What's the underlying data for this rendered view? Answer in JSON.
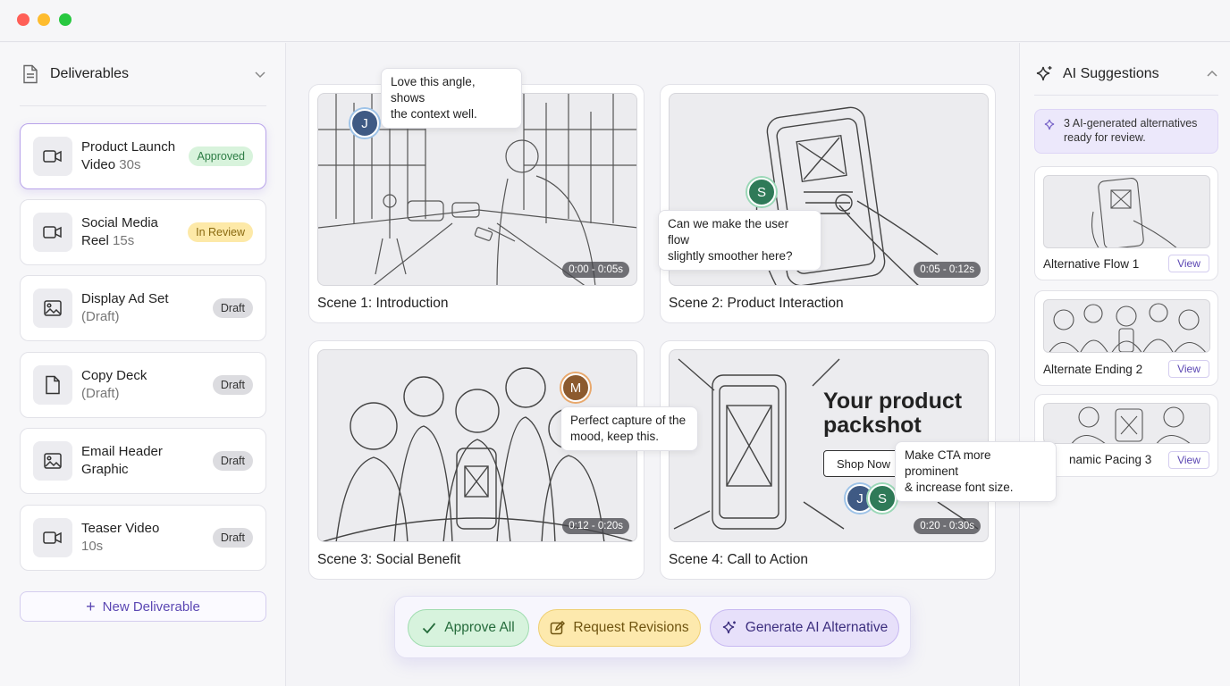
{
  "sidebar": {
    "title": "Deliverables",
    "items": [
      {
        "title": "Product Launch",
        "title2": "Video",
        "sub": "30s",
        "status": "Approved",
        "icon": "video-icon"
      },
      {
        "title": "Social Media",
        "title2": "Reel",
        "sub": "15s",
        "status": "In Review",
        "icon": "video-icon"
      },
      {
        "title": "Display Ad Set",
        "title2": "",
        "sub": "(Draft)",
        "status": "Draft",
        "icon": "image-icon"
      },
      {
        "title": "Copy Deck",
        "title2": "",
        "sub": "(Draft)",
        "status": "Draft",
        "icon": "document-icon"
      },
      {
        "title": "Email Header",
        "title2": "Graphic",
        "sub": "",
        "status": "Draft",
        "icon": "image-icon"
      },
      {
        "title": "Teaser Video",
        "title2": "",
        "sub": "10s",
        "status": "Draft",
        "icon": "video-icon"
      }
    ],
    "new_label": "New Deliverable"
  },
  "scenes": [
    {
      "label": "Scene 1: Introduction",
      "time": "0:00 - 0:05s"
    },
    {
      "label": "Scene 2: Product Interaction",
      "time": "0:05 - 0:12s"
    },
    {
      "label": "Scene 3: Social Benefit",
      "time": "0:12 - 0:20s"
    },
    {
      "label": "Scene 4: Call to Action",
      "time": "0:20 - 0:30s"
    }
  ],
  "scene4": {
    "headline1": "Your product",
    "headline2": "packshot",
    "button": "Shop Now"
  },
  "comments": [
    {
      "line1": "Love this angle, shows",
      "line2": "the context well."
    },
    {
      "line1": "Can we make the user flow",
      "line2": "slightly smoother here?"
    },
    {
      "line1": "Perfect capture of the",
      "line2": "mood, keep this."
    },
    {
      "line1": "Make CTA more prominent",
      "line2": "& increase font size."
    }
  ],
  "avatars": {
    "j": "J",
    "s": "S",
    "m": "M"
  },
  "actions": {
    "approve": "Approve All",
    "revise": "Request Revisions",
    "generate": "Generate AI Alternative"
  },
  "ai_panel": {
    "title": "AI Suggestions",
    "note": "3 AI-generated alternatives ready for review.",
    "alternatives": [
      {
        "label": "Alternative Flow 1",
        "view": "View"
      },
      {
        "label": "Alternate Ending 2",
        "view": "View"
      },
      {
        "label": "namic Pacing 3",
        "view": "View"
      }
    ]
  },
  "colors": {
    "accent": "#5b47b3",
    "approved": "#2d7d45",
    "review": "#fde9a8",
    "draft": "#dcdce0"
  }
}
